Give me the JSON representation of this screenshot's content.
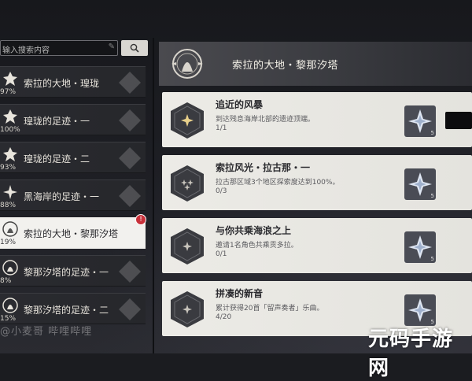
{
  "search": {
    "placeholder": "输入搜索内容",
    "clear_icon": "edit-clear-icon"
  },
  "sidebar": {
    "items": [
      {
        "label": "索拉的大地・瑝珑",
        "percent": "97%"
      },
      {
        "label": "瑝珑的足迹・一",
        "percent": "100%"
      },
      {
        "label": "瑝珑的足迹・二",
        "percent": "93%"
      },
      {
        "label": "黑海岸的足迹・一",
        "percent": "88%"
      },
      {
        "label": "索拉的大地・黎那汐塔",
        "percent": "19%",
        "selected": true,
        "badge": "!"
      },
      {
        "label": "黎那汐塔的足迹・一",
        "percent": "8%"
      },
      {
        "label": "黎那汐塔的足迹・二",
        "percent": "15%"
      }
    ]
  },
  "header": {
    "title": "索拉的大地・黎那汐塔"
  },
  "achievements": [
    {
      "name": "追近的风暴",
      "desc": "到达残息海岸北部的遗迹顶端。",
      "progress": "1/1",
      "reward_count": "5",
      "completed": true
    },
    {
      "name": "索拉风光・拉古那・一",
      "desc": "拉古那区域3个地区探索度达到100%。",
      "progress": "0/3",
      "reward_count": "5",
      "completed": false
    },
    {
      "name": "与你共乘海浪之上",
      "desc": "邀请1名角色共乘贡多拉。",
      "progress": "0/1",
      "reward_count": "5",
      "completed": false
    },
    {
      "name": "拼凑的新音",
      "desc": "累计获得20首「留声奏者」乐曲。",
      "progress": "4/20",
      "reward_count": "5",
      "completed": false
    }
  ],
  "watermarks": {
    "left": "@小麦哥 哔哩哔哩",
    "right": "元码手游网"
  },
  "colors": {
    "selected_bg": "#f2f1ee",
    "card_bg": "#ecebe6",
    "badge": "#c8303a",
    "hex_dark": "#3a3b40"
  }
}
